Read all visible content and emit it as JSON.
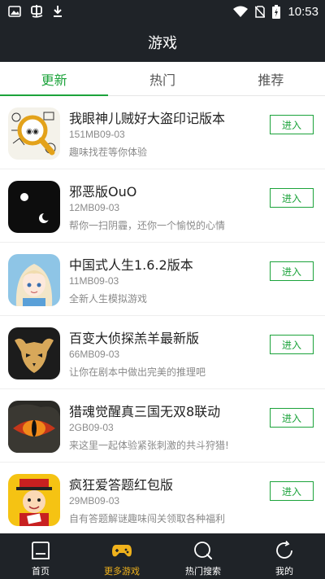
{
  "status_bar": {
    "time": "10:53",
    "icons": [
      "image-icon",
      "bug-icon",
      "download-icon",
      "wifi-icon",
      "no-sim-icon",
      "battery-charging-icon"
    ]
  },
  "header": {
    "title": "游戏"
  },
  "tabs": [
    {
      "label": "更新",
      "active": true
    },
    {
      "label": "热门",
      "active": false
    },
    {
      "label": "推荐",
      "active": false
    }
  ],
  "games": [
    {
      "name": "我眼神儿贼好大盗印记版本",
      "size": "151MB",
      "date": "09-03",
      "desc": "趣味找茬等你体验",
      "button": "进入",
      "icon": "magnifier-doodle-icon"
    },
    {
      "name": "邪恶版OuO",
      "size": "12MB",
      "date": "09-03",
      "desc": "帮你一扫阴霾，还你一个愉悦的心情",
      "button": "进入",
      "icon": "dark-face-icon"
    },
    {
      "name": "中国式人生1.6.2版本",
      "size": "11MB",
      "date": "09-03",
      "desc": "全新人生模拟游戏",
      "button": "进入",
      "icon": "anime-girl-icon"
    },
    {
      "name": "百变大侦探羔羊最新版",
      "size": "66MB",
      "date": "09-03",
      "desc": "让你在剧本中做出完美的推理吧",
      "button": "进入",
      "icon": "lamb-mask-icon"
    },
    {
      "name": "猎魂觉醒真三国无双8联动",
      "size": "2GB",
      "date": "09-03",
      "desc": "来这里一起体验紧张刺激的共斗狩猎!",
      "button": "进入",
      "icon": "dragon-eye-icon"
    },
    {
      "name": "疯狂爱答题红包版",
      "size": "29MB",
      "date": "09-03",
      "desc": "自有答题解谜趣味闯关领取各种福利",
      "button": "进入",
      "icon": "emperor-cartoon-icon"
    }
  ],
  "bottom_nav": [
    {
      "label": "首页",
      "icon": "home-icon",
      "active": false
    },
    {
      "label": "更多游戏",
      "icon": "gamepad-icon",
      "active": true
    },
    {
      "label": "热门搜索",
      "icon": "search-icon",
      "active": false
    },
    {
      "label": "我的",
      "icon": "profile-refresh-icon",
      "active": false
    }
  ],
  "colors": {
    "accent": "#1ca33b",
    "bar": "#1f2328",
    "nav_active": "#f0b21c"
  }
}
